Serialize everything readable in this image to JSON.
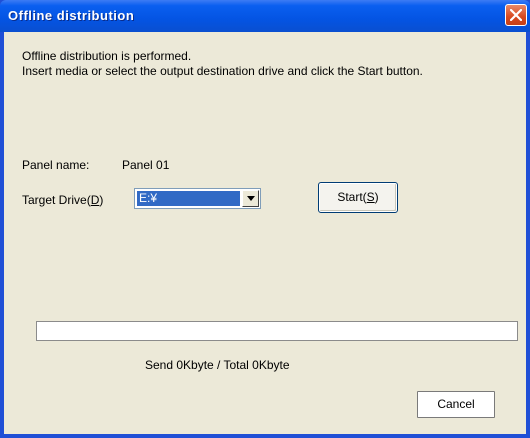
{
  "window": {
    "title": "Offline distribution"
  },
  "message": {
    "line1": "Offline distribution is performed.",
    "line2": "Insert media or select the output destination drive and click the Start button."
  },
  "panel": {
    "label": "Panel name:",
    "value": "Panel 01"
  },
  "target_drive": {
    "label": "Target Drive(",
    "mnemonic": "D",
    "label_suffix": ")",
    "selected": "E:¥"
  },
  "start_button": {
    "label": "Start(",
    "mnemonic": "S",
    "label_suffix": ")"
  },
  "progress": {
    "value": 0
  },
  "status": {
    "text": "Send 0Kbyte / Total 0Kbyte"
  },
  "cancel_button": {
    "label": "Cancel"
  },
  "colors": {
    "titlebar": "#0454e3",
    "close": "#d8491f",
    "dialog_bg": "#ece9d8",
    "selection": "#316ac5"
  }
}
